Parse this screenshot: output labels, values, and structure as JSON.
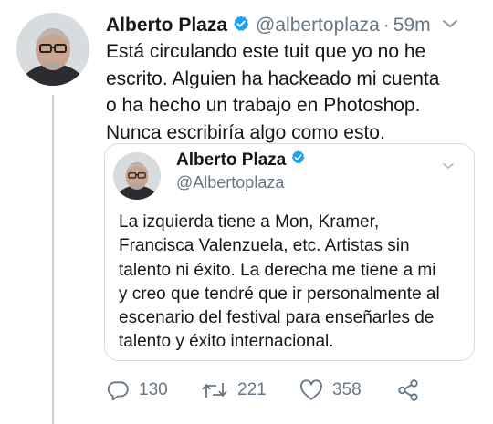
{
  "tweet": {
    "author_name": "Alberto Plaza",
    "handle": "@albertoplaza",
    "separator": "·",
    "time": "59m",
    "text": "Está circulando este tuit que yo no he\nescrito. Alguien ha hackeado mi cuenta\no ha hecho un trabajo en Photoshop.\nNunca escribiría algo como esto."
  },
  "quoted_tweet": {
    "author_name": "Alberto Plaza",
    "handle": "@Albertoplaza",
    "text": "La izquierda tiene a Mon, Kramer,\nFrancisca Valenzuela, etc. Artistas sin\ntalento ni éxito. La derecha me tiene a mi\ny creo que tendré que ir personalmente al\nescenario del festival para enseñarles de\ntalento y éxito internacional."
  },
  "actions": {
    "replies": "130",
    "retweets": "221",
    "likes": "358"
  },
  "colors": {
    "verified": "#1da1f2",
    "secondary_text": "#657786",
    "border": "#d6dde2"
  },
  "icons": [
    "avatar",
    "verified-badge-icon",
    "chevron-down-icon",
    "reply-icon",
    "retweet-icon",
    "like-icon",
    "share-icon"
  ]
}
